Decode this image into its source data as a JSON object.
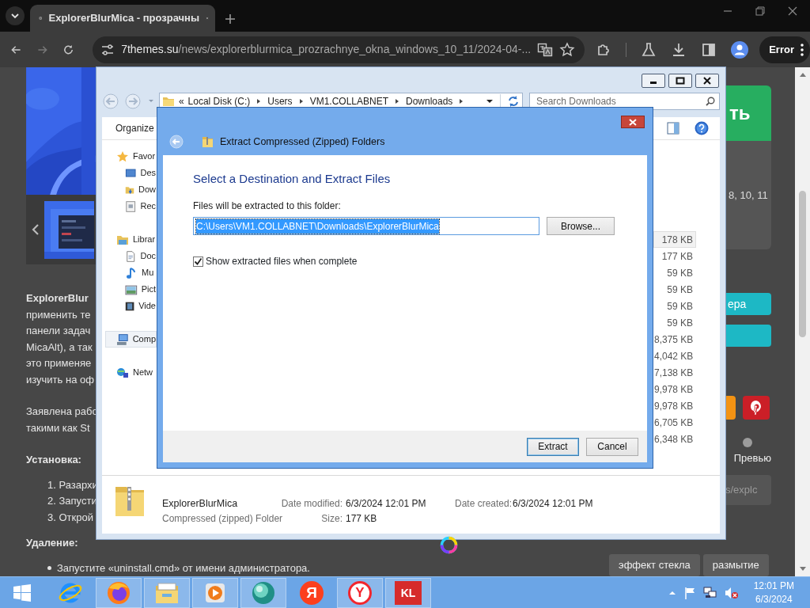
{
  "browser": {
    "tabs": [
      {
        "title": "ExplorerBlurMica - прозрачны",
        "selected": true
      }
    ],
    "url": {
      "host": "7themes.su",
      "path": "/news/explorerblurmica_prozrachnye_okna_windows_10_11/2024-04-..."
    },
    "profile_button": "Error"
  },
  "webpage": {
    "article": [
      {
        "kind": "paragraph",
        "lines": [
          "**ExplorerBlur**",
          "применить те",
          "панели задач",
          "MicaAlt), а так",
          "это применяе",
          "изучить на оф"
        ]
      },
      {
        "kind": "paragraph",
        "lines": [
          "Заявлена рабо",
          "такими как St"
        ]
      },
      {
        "kind": "heading",
        "text": "Установка:"
      },
      {
        "kind": "numbered",
        "items": [
          "1. Разархи",
          "2. Запусти",
          "3. Открой"
        ]
      },
      {
        "kind": "heading",
        "text": "Удаление:"
      },
      {
        "kind": "bulleted",
        "items": [
          "Запустите «uninstall.cmd» от имени администратора."
        ]
      }
    ],
    "sidebar": {
      "download_button": "ть",
      "info_card": "8, 10, 11",
      "action_button": "ера",
      "share_buttons": [
        {
          "kind": "plain",
          "color": "#f39313"
        },
        {
          "kind": "pinterest",
          "color": "#cb1f27"
        }
      ],
      "preview_selected": false,
      "preview_label": "Превью",
      "link_field": "s/explc",
      "tags": [
        "эффект стекла",
        "размытие"
      ]
    }
  },
  "explorer": {
    "overflow_glyph": "«",
    "breadcrumb": [
      "Local Disk (C:)",
      "Users",
      "VM1.COLLABNET",
      "Downloads"
    ],
    "search_placeholder": "Search Downloads",
    "organize": "Organize",
    "nav": [
      {
        "label": "Favor",
        "kind": "star",
        "selected": false,
        "children": [
          {
            "label": "Des",
            "kind": "desktop",
            "selected": false
          },
          {
            "label": "Dow",
            "kind": "downloads",
            "selected": false
          },
          {
            "label": "Rec",
            "kind": "recent",
            "selected": false
          }
        ]
      },
      {
        "label": "Librar",
        "kind": "library",
        "selected": false,
        "children": [
          {
            "label": "Doc",
            "kind": "documents",
            "selected": false
          },
          {
            "label": "Mu",
            "kind": "music",
            "selected": false
          },
          {
            "label": "Pict",
            "kind": "pictures",
            "selected": false
          },
          {
            "label": "Vide",
            "kind": "videos",
            "selected": false
          }
        ]
      },
      {
        "label": "Comp",
        "kind": "computer",
        "selected": true
      },
      {
        "label": "Netw",
        "kind": "network",
        "selected": false
      }
    ],
    "files": [
      {
        "size": "178 KB",
        "selected": true
      },
      {
        "size": "177 KB",
        "selected": false
      },
      {
        "size": "59 KB",
        "selected": false
      },
      {
        "size": "59 KB",
        "selected": false
      },
      {
        "size": "59 KB",
        "selected": false
      },
      {
        "size": "59 KB",
        "selected": false
      },
      {
        "size": "8,375 KB",
        "selected": false
      },
      {
        "size": "4,042 KB",
        "selected": false
      },
      {
        "size": "7,138 KB",
        "selected": false
      },
      {
        "size": "9,978 KB",
        "selected": false
      },
      {
        "size": "9,978 KB",
        "selected": false
      },
      {
        "size": "6,705 KB",
        "selected": false
      },
      {
        "size": "6,348 KB",
        "selected": false
      }
    ],
    "details": {
      "name": "ExplorerBlurMica",
      "type": "Compressed (zipped) Folder",
      "fields": [
        {
          "label": "Date modified:",
          "value": "6/3/2024 12:01 PM"
        },
        {
          "label": "Size:",
          "value": "177 KB"
        },
        {
          "label": "Date created:",
          "value": "6/3/2024 12:01 PM"
        }
      ]
    }
  },
  "dialog": {
    "title": "Extract Compressed (Zipped) Folders",
    "heading": "Select a Destination and Extract Files",
    "path_label": "Files will be extracted to this folder:",
    "path": {
      "value": "C:\\Users\\VM1.COLLABNET\\Downloads\\ExplorerBlurMica",
      "selected": true
    },
    "browse": "Browse...",
    "show_files": {
      "label": "Show extracted files when complete",
      "checked": true
    },
    "buttons": [
      {
        "label": "Extract",
        "default": true
      },
      {
        "label": "Cancel",
        "default": false
      }
    ]
  },
  "taskbar": {
    "apps": [
      {
        "kind": "ie",
        "running": false
      },
      {
        "kind": "firefox",
        "running": true
      },
      {
        "kind": "explorer",
        "running": true
      },
      {
        "kind": "media",
        "running": true
      },
      {
        "kind": "orb",
        "running": true
      },
      {
        "kind": "yandex",
        "label": "Я",
        "running": false
      },
      {
        "kind": "yandex-browser",
        "label": "Y",
        "running": true
      },
      {
        "kind": "kaspersky",
        "label": "KL",
        "running": true
      }
    ],
    "clock": {
      "time": "12:01 PM",
      "date": "6/3/2024"
    }
  }
}
